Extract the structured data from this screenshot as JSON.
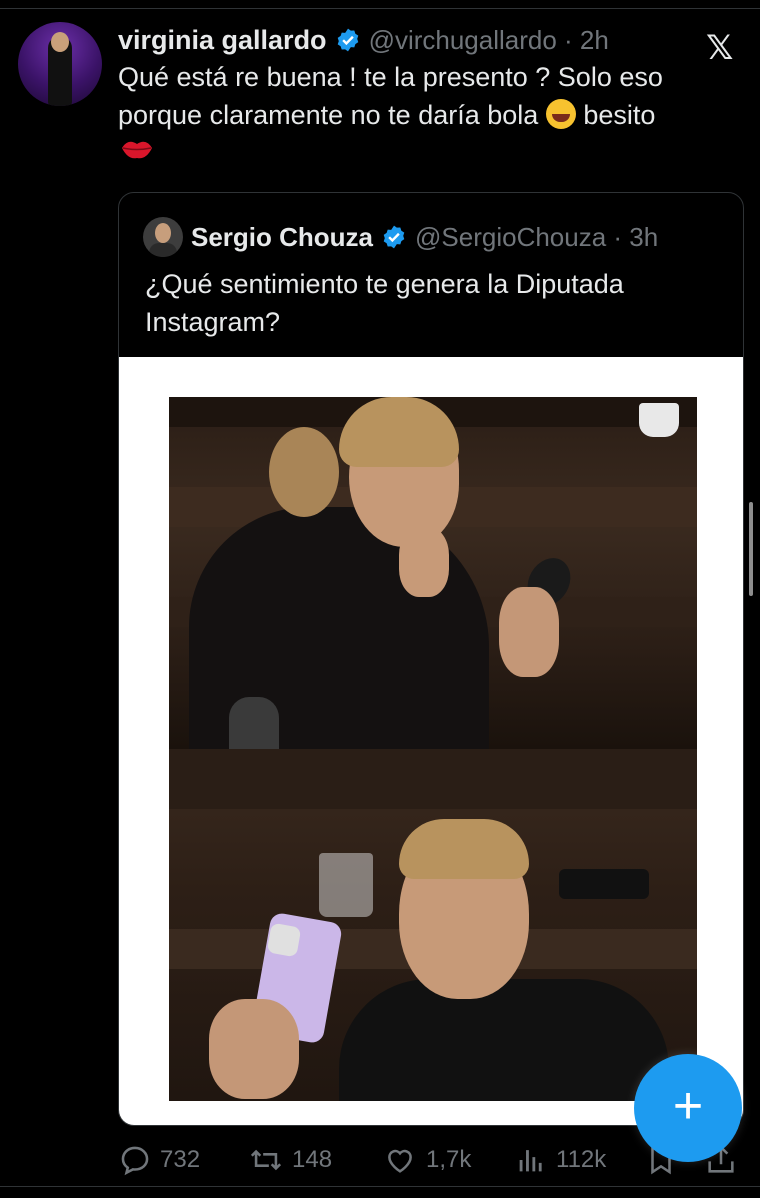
{
  "tweet": {
    "author_name": "virginia gallardo",
    "handle_time": "@virchugallardo · 2h",
    "text": "Qué está re buena ! te la presento ? Solo eso porque claramente no te daría bola",
    "text_tail": "besito",
    "platform_icon": "x-logo-icon"
  },
  "quote": {
    "author_name": "Sergio Chouza",
    "handle_time": "@SergioChouza · 3h",
    "text": "¿Qué sentimiento te genera la Diputada Instagram?"
  },
  "actions": {
    "replies": "732",
    "reposts": "148",
    "likes": "1,7k",
    "views": "112k"
  },
  "colors": {
    "accent": "#1d9bf0",
    "background": "#000000",
    "text": "#e7e9ea",
    "muted": "#71767b"
  }
}
